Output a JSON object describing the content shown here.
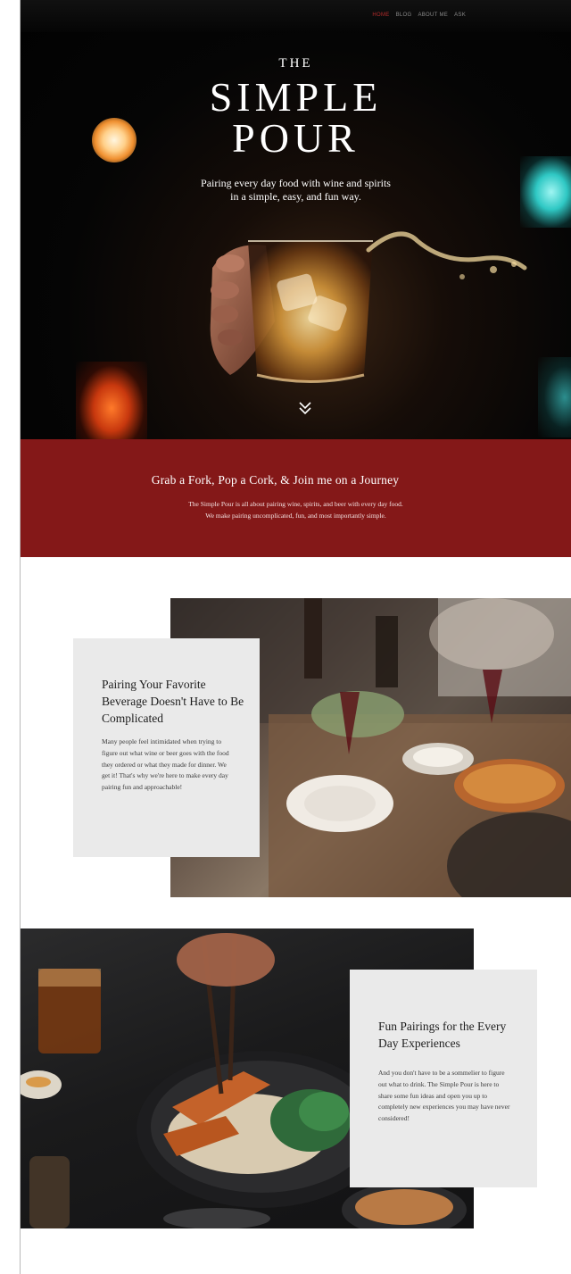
{
  "nav": {
    "items": [
      {
        "label": "Home",
        "active": true
      },
      {
        "label": "Blog",
        "active": false
      },
      {
        "label": "About Me",
        "active": false
      },
      {
        "label": "Ask",
        "active": false
      }
    ]
  },
  "hero": {
    "title_small": "THE",
    "title_line1": "SIMPLE",
    "title_line2": "POUR",
    "tagline_line1": "Pairing every day food with wine and spirits",
    "tagline_line2": "in a simple, easy, and fun way.",
    "scroll_icon": "double-chevron-down-icon"
  },
  "intro": {
    "title": "Grab a Fork, Pop a Cork, & Join me on a Journey",
    "text_line1": "The Simple Pour is all about pairing wine, spirits, and beer with every day food.",
    "text_line2": "We make pairing uncomplicated, fun, and most importantly simple."
  },
  "section1": {
    "title": "Pairing Your Favorite Beverage Doesn't Have to Be Complicated",
    "text": "Many people feel intimidated when trying to figure out what wine or beer goes with the food they ordered or what they made for dinner. We get it! That's why we're here to make every day pairing fun and approachable!"
  },
  "section2": {
    "title": "Fun Pairings for the Every Day Experiences",
    "text": "And you don't have to be a sommelier to figure out what to drink. The Simple Pour is here to share some fun ideas and open you up to completely new experiences you may have never considered!"
  },
  "colors": {
    "accent_red": "#841818",
    "nav_active": "#b52b2b",
    "card_bg": "#eaeaea"
  }
}
